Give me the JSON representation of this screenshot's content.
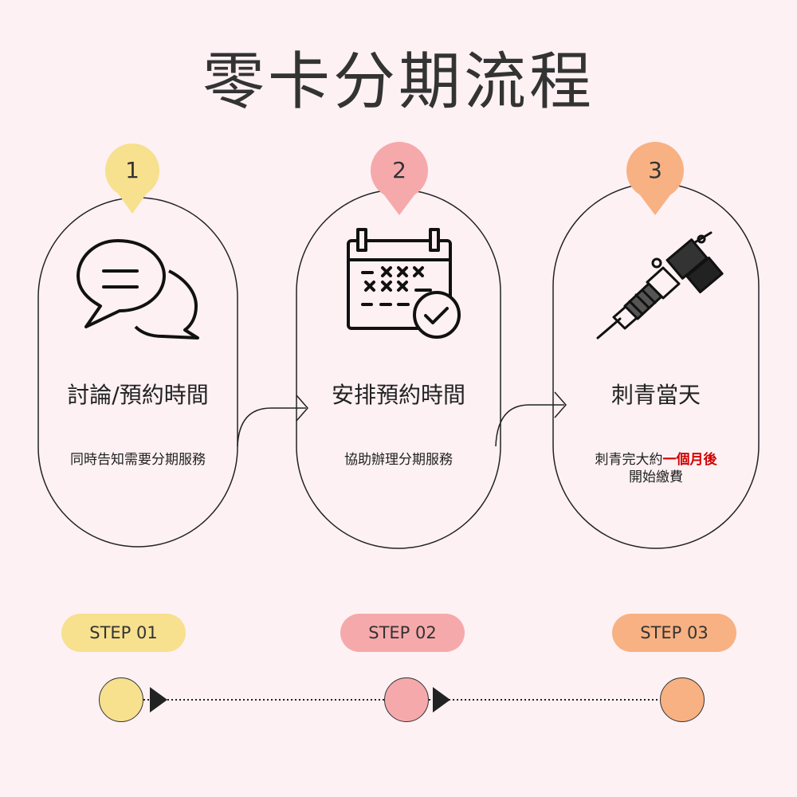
{
  "title": "零卡分期流程",
  "colors": {
    "step1": "#f7e08e",
    "step2": "#f6a9ab",
    "step3": "#f8b182",
    "highlight": "#d20000",
    "background": "#fdf1f4"
  },
  "steps": [
    {
      "number": "1",
      "icon": "chat-bubbles-icon",
      "title": "討論/預約時間",
      "desc_line1": "同時告知需要分期服務",
      "pill": "STEP 01"
    },
    {
      "number": "2",
      "icon": "calendar-check-icon",
      "title": "安排預約時間",
      "desc_line1": "協助辦理分期服務",
      "pill": "STEP 02"
    },
    {
      "number": "3",
      "icon": "tattoo-machine-icon",
      "title": "刺青當天",
      "desc_pre": "刺青完大約",
      "desc_highlight": "一個月後",
      "desc_line2": "開始繳費",
      "pill": "STEP 03"
    }
  ]
}
